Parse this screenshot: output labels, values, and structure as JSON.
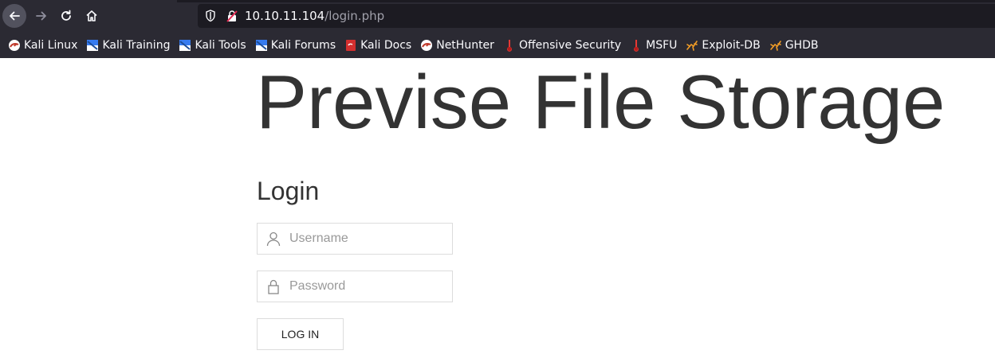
{
  "browser": {
    "url": {
      "host": "10.10.11.104",
      "path": "/login.php"
    },
    "bookmarks": [
      {
        "label": "Kali Linux",
        "icon": "kali-icon"
      },
      {
        "label": "Kali Training",
        "icon": "kali-training-icon"
      },
      {
        "label": "Kali Tools",
        "icon": "kali-tools-icon"
      },
      {
        "label": "Kali Forums",
        "icon": "kali-forums-icon"
      },
      {
        "label": "Kali Docs",
        "icon": "kali-docs-icon"
      },
      {
        "label": "NetHunter",
        "icon": "nethunter-icon"
      },
      {
        "label": "Offensive Security",
        "icon": "offsec-icon"
      },
      {
        "label": "MSFU",
        "icon": "msfu-icon"
      },
      {
        "label": "Exploit-DB",
        "icon": "exploit-db-icon"
      },
      {
        "label": "GHDB",
        "icon": "ghdb-icon"
      }
    ]
  },
  "page": {
    "site_title": "Previse File Storage",
    "login_heading": "Login",
    "username_placeholder": "Username",
    "password_placeholder": "Password",
    "login_button": "LOG IN"
  },
  "colors": {
    "toolbar_bg": "#2b2a33",
    "urlbar_bg": "#1c1b22",
    "title_text": "#333333",
    "field_border": "#dcdcdc"
  }
}
